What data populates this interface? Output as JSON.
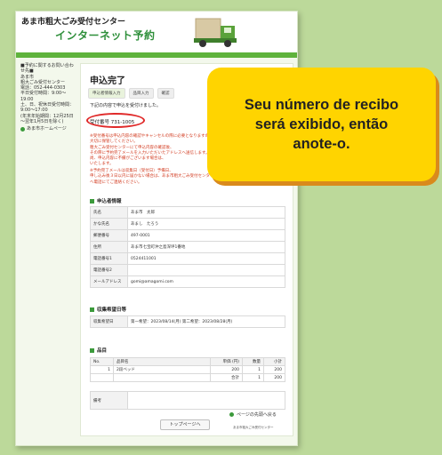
{
  "header": {
    "org": "あま市粗大ごみ受付センター",
    "service": "インターネット予約"
  },
  "sidebar": {
    "lines": [
      "■予約に関するお問い合わせ先■",
      "あま市",
      "粗大ごみ受付センター",
      "電話：052-444-0303",
      "平日受付時間：9:00～19:00",
      "土、日、祝休日受付時間：9:00～17:00",
      "(年末年始期間：12月25日～翌年1月5日を除く)"
    ],
    "home_link": "あま市ホームページ"
  },
  "main": {
    "title": "申込完了",
    "steps": [
      "申込者情報入力",
      "品目入力",
      "確認"
    ],
    "message": "下記の内容で申込を受付けました。",
    "receipt_label": "受付番号",
    "receipt_number": "731-1005",
    "note_lines": [
      "※受付番号は申込内容の確認やキャンセルの際に必要となりますので、",
      "大切に保管してください。",
      "粗大ごみ受付センターにて申込内容の確認後、",
      "その際に予約完了メールを入力いただいたアドレスへ送信します。",
      "尚、申込内容に不備がございます場合は、",
      "いたします。"
    ],
    "note2_lines": [
      "※予約完了メールは収集日（受付日）予備日、",
      "申し込み後３日以内に届かない場合は、あま市粗大ごみ受付センター",
      "へ電話にてご連絡ください。"
    ]
  },
  "applicant": {
    "heading": "申込者情報",
    "rows": [
      {
        "label": "氏名",
        "value": "あま市　太郎"
      },
      {
        "label": "かな氏名",
        "value": "あまし　たろう"
      },
      {
        "label": "郵便番号",
        "value": "497-0001"
      },
      {
        "label": "住所",
        "value": "あま市七宝町沖之島深坪1番地"
      },
      {
        "label": "電話番号1",
        "value": "0524411001"
      },
      {
        "label": "電話番号2",
        "value": ""
      },
      {
        "label": "メールアドレス",
        "value": "gomi@amagomi.com"
      }
    ]
  },
  "collection": {
    "heading": "収集希望日等",
    "label": "収集希望日",
    "value": "第一希望：2023/08/14(月) 第二希望：2023/08/28(月)"
  },
  "items": {
    "heading": "品目",
    "columns": [
      "No.",
      "品目名",
      "単価 (円)",
      "数量",
      "小計"
    ],
    "rows": [
      {
        "no": "1",
        "name": "2段ベッド",
        "price": "200",
        "qty": "1",
        "subtotal": "200"
      }
    ],
    "total_label": "合計",
    "total_qty": "1",
    "total": "200",
    "remarks_label": "備考"
  },
  "buttons": {
    "top": "トップページへ",
    "back": "ページの先頭へ戻る"
  },
  "footer": "あま市粗大ごみ受付センター",
  "callout": "Seu número de recibo será exibido, então anote-o."
}
